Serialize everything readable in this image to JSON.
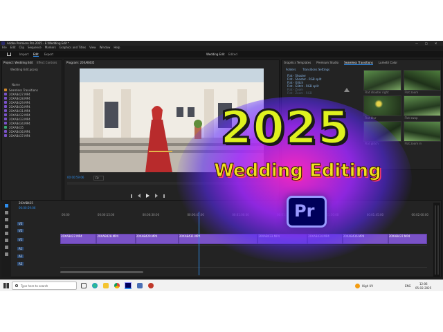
{
  "window": {
    "title": "Adobe Premiere Pro 2025 - E:\\Wedding Edit *",
    "controls": [
      "—",
      "□",
      "✕"
    ]
  },
  "menu": [
    "File",
    "Edit",
    "Clip",
    "Sequence",
    "Markers",
    "Graphics and Titles",
    "View",
    "Window",
    "Help"
  ],
  "nav": {
    "home_icon": "home-icon",
    "tabs": [
      "Import",
      "Edit",
      "Export"
    ],
    "active_tab": "Edit",
    "project_name": "Wedding Edit",
    "project_state": "Edited"
  },
  "project_panel": {
    "tabs": [
      "Project: Wedding Edit",
      "Effect Controls"
    ],
    "file_name": "Wedding Edit.prproj",
    "column_header": "Name",
    "items": [
      {
        "name": "Seamless Transitions",
        "color": "#d08a2c",
        "kind": "folder"
      },
      {
        "name": "20XAB427.MP4",
        "color": "#7a52c7"
      },
      {
        "name": "20XAB428.MP4",
        "color": "#7a52c7"
      },
      {
        "name": "20XAB429.MP4",
        "color": "#7a52c7"
      },
      {
        "name": "20XAB430.MP4",
        "color": "#7a52c7"
      },
      {
        "name": "20XAB431.MP4",
        "color": "#7a52c7"
      },
      {
        "name": "20XAB432.MP4",
        "color": "#7a52c7"
      },
      {
        "name": "20XAB433.MP4",
        "color": "#7a52c7"
      },
      {
        "name": "20XAB434.MP4",
        "color": "#7a52c7"
      },
      {
        "name": "20XAB435",
        "color": "#3aa876"
      },
      {
        "name": "20XAB436.MP4",
        "color": "#7a52c7"
      },
      {
        "name": "20XAB437.MP4",
        "color": "#7a52c7"
      }
    ]
  },
  "program_monitor": {
    "tab": "Program: 20XAB435",
    "timecode": "00:00:59:06",
    "fit": "Fit"
  },
  "graphics_panel": {
    "tabs": [
      "Graphics Templates",
      "Premium Studio",
      "Seamless Transitions",
      "Lumetri Color"
    ],
    "active_tab": "Seamless Transitions",
    "subtabs": [
      "Folders",
      "Transitions Settings"
    ],
    "folders": [
      "Flat - Shooter",
      "Flat - Shooter - RGB split",
      "Flat - Glitch",
      "Flat - Glitch - RGB split",
      "Flat - Zoom",
      "Flat - Zoom - RGB"
    ],
    "thumbs": [
      "Flat shooter right",
      "Flat zoom",
      "Flat blur",
      "Flat swap",
      "Flat glitch",
      "Flat zoom in",
      "Flat zoom out",
      "Flat rotate",
      "Flat warp right"
    ]
  },
  "timeline": {
    "sequence": "20XAB435",
    "timecode": "00:00:59:06",
    "ruler": [
      "00:00",
      "00:00:15:00",
      "00:00:30:00",
      "00:00:45:00",
      "00:01:00:00",
      "00:01:15:00",
      "00:01:30:00",
      "00:01:45:00",
      "00:02:00:00"
    ],
    "video_tracks": [
      "V3",
      "V2",
      "V1"
    ],
    "audio_tracks": [
      "A1",
      "A2",
      "A3"
    ],
    "clips": [
      "20XAB427.MP4",
      "20XAB428.MP4",
      "20XAB429.MP4",
      "20XAB431.MP4",
      "20XAB433.MP4",
      "20XAB434.MP4",
      "20XAB436.MP4",
      "20XAB437.MP4"
    ]
  },
  "overlay": {
    "year": "2025",
    "subtitle": "Wedding Editing",
    "logo_text": "Pr"
  },
  "taskbar": {
    "search_placeholder": "Type here to search",
    "weather": "High UV",
    "lang": "ENG",
    "time": "12:06",
    "date": "05-02-2025"
  },
  "colors": {
    "accent_yellow": "#dff21f",
    "premiere_purple": "#9999ff",
    "premiere_bg": "#00005b",
    "clip_purple": "#7a52c7",
    "playhead_blue": "#2d8ceb"
  }
}
